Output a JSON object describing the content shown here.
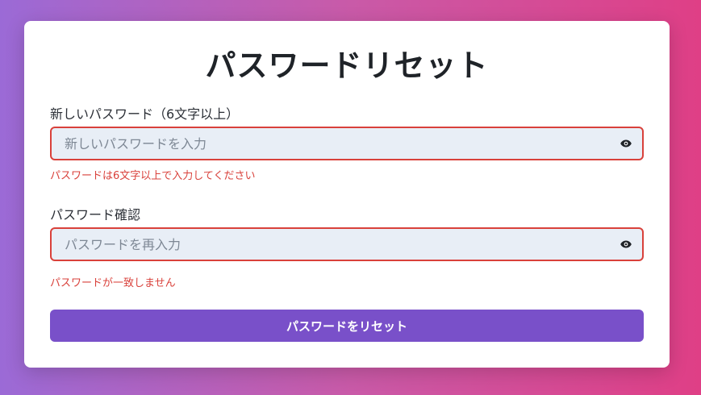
{
  "page": {
    "title": "パスワードリセット"
  },
  "new_password": {
    "label": "新しいパスワード（6文字以上）",
    "placeholder": "新しいパスワードを入力",
    "value": "",
    "error": "パスワードは6文字以上で入力してください",
    "toggle_icon": "eye-icon"
  },
  "confirm_password": {
    "label": "パスワード確認",
    "placeholder": "パスワードを再入力",
    "value": "",
    "error": "パスワードが一致しません",
    "toggle_icon": "eye-icon"
  },
  "submit": {
    "label": "パスワードをリセット"
  },
  "colors": {
    "background_gradient_start": "#9b6ad6",
    "background_gradient_end": "#df3f86",
    "error": "#d9413b",
    "input_background": "#e8eef6",
    "button": "#7950c9"
  }
}
